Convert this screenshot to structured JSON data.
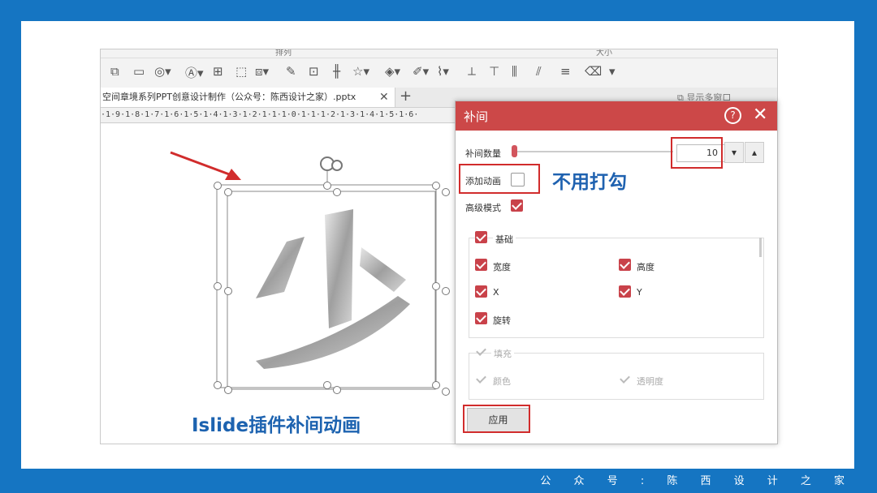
{
  "footer": "公 众 号 : 陈 西 设 计 之 家",
  "ribbon_groups": [
    "排列",
    "大小",
    "大小"
  ],
  "toolbar_icons": [
    "arrange-icon",
    "fill-icon",
    "shapes-icon",
    "textbox-icon",
    "align-icon",
    "group-icon",
    "format-icon",
    "paint-icon",
    "highlight-icon",
    "star-icon",
    "bucket-icon",
    "pen-icon",
    "brush-icon",
    "crop-icon",
    "align-top-icon",
    "distribute-icon",
    "distribute2-icon",
    "align-left-icon",
    "eraser-icon",
    "more-icon"
  ],
  "doc_tab": {
    "name": "空间章境系列PPT创意设计制作（公众号：陈西设计之家）.pptx",
    "close": "✕",
    "add": "+"
  },
  "show_multi": "显示多窗口",
  "ruler_text": "·1·9·1·8·1·7·1·6·1·5·1·4·1·3·1·2·1·1·1·0·1·1·1·2·1·3·1·4·1·5·1·6·",
  "canvas": {
    "glyph": "少",
    "caption": "Islide插件补间动画"
  },
  "dialog": {
    "title": "补间",
    "help": "?",
    "close": "✕",
    "tween_count_label": "补间数量",
    "tween_count": "10",
    "tween_count_fraction": 0.0,
    "add_animation_label": "添加动画",
    "advanced_label": "高级模式",
    "basic_group": {
      "label": "基础",
      "items": [
        "宽度",
        "高度",
        "X",
        "Y",
        "旋转"
      ]
    },
    "fill_group": {
      "label": "填充",
      "items": [
        "颜色",
        "透明度"
      ]
    },
    "apply": "应用"
  },
  "annotation": "不用打勾",
  "colors": {
    "frame_blue": "#1575c2",
    "dialog_red": "#cc4848",
    "highlight_red": "#d12c2c",
    "note_blue": "#1f62b0"
  }
}
